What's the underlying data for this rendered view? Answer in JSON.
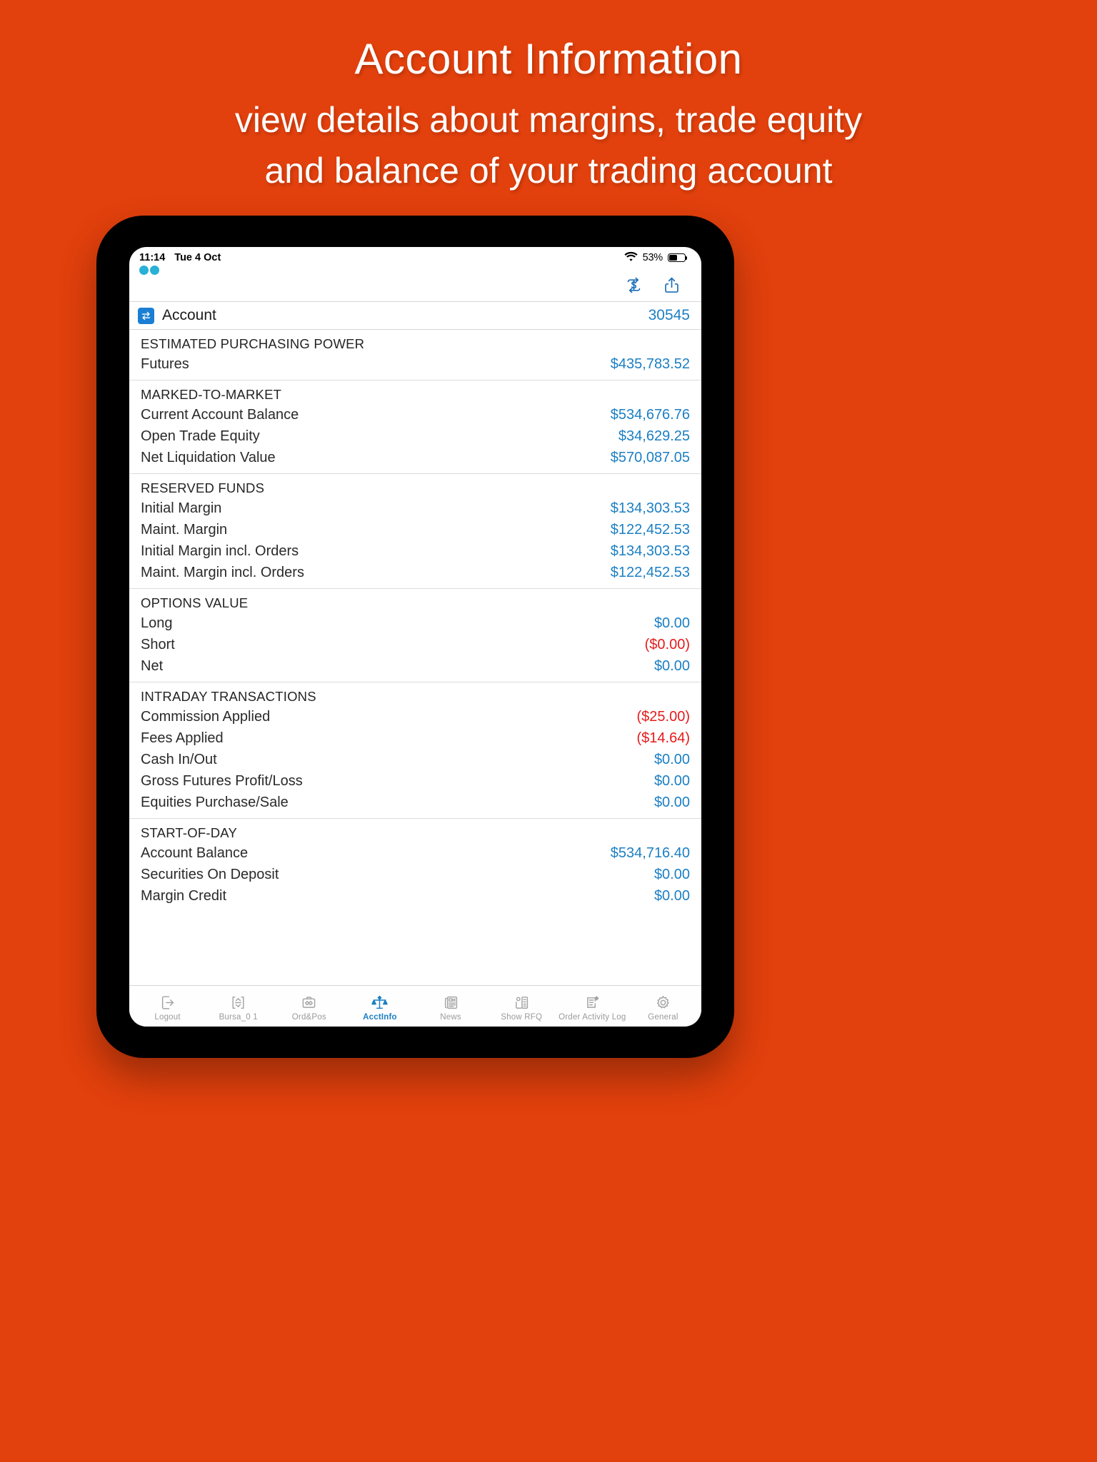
{
  "promo": {
    "title": "Account Information",
    "subtitle_line1": "view details about margins, trade equity",
    "subtitle_line2": "and balance of your trading account",
    "background_color": "#e2400c",
    "text_color": "#ffffff"
  },
  "status_bar": {
    "time": "11:14",
    "date": "Tue 4 Oct",
    "wifi_icon": "wifi-icon",
    "battery_percent": "53%",
    "battery_icon": "battery-icon"
  },
  "toolbar": {
    "currency_refresh_icon": "currency-refresh-icon",
    "share_icon": "share-icon"
  },
  "account": {
    "badge_icon": "switch-account-icon",
    "label": "Account",
    "value": "30545"
  },
  "colors": {
    "value_positive": "#1b7fc4",
    "value_negative": "#e51b1b",
    "accent": "#1b7fc4"
  },
  "sections": [
    {
      "title": "ESTIMATED PURCHASING POWER",
      "rows": [
        {
          "label": "Futures",
          "value": "$435,783.52",
          "tone": "blue"
        }
      ]
    },
    {
      "title": "MARKED-TO-MARKET",
      "rows": [
        {
          "label": "Current Account Balance",
          "value": "$534,676.76",
          "tone": "blue"
        },
        {
          "label": "Open Trade Equity",
          "value": "$34,629.25",
          "tone": "blue"
        },
        {
          "label": "Net Liquidation Value",
          "value": "$570,087.05",
          "tone": "blue"
        }
      ]
    },
    {
      "title": "RESERVED FUNDS",
      "rows": [
        {
          "label": "Initial Margin",
          "value": "$134,303.53",
          "tone": "blue"
        },
        {
          "label": "Maint. Margin",
          "value": "$122,452.53",
          "tone": "blue"
        },
        {
          "label": "Initial Margin incl. Orders",
          "value": "$134,303.53",
          "tone": "blue"
        },
        {
          "label": "Maint. Margin incl. Orders",
          "value": "$122,452.53",
          "tone": "blue"
        }
      ]
    },
    {
      "title": "OPTIONS VALUE",
      "rows": [
        {
          "label": "Long",
          "value": "$0.00",
          "tone": "blue"
        },
        {
          "label": "Short",
          "value": "($0.00)",
          "tone": "red"
        },
        {
          "label": "Net",
          "value": "$0.00",
          "tone": "blue"
        }
      ]
    },
    {
      "title": "INTRADAY TRANSACTIONS",
      "rows": [
        {
          "label": "Commission Applied",
          "value": "($25.00)",
          "tone": "red"
        },
        {
          "label": "Fees Applied",
          "value": "($14.64)",
          "tone": "red"
        },
        {
          "label": "Cash In/Out",
          "value": "$0.00",
          "tone": "blue"
        },
        {
          "label": "Gross Futures Profit/Loss",
          "value": "$0.00",
          "tone": "blue"
        },
        {
          "label": "Equities Purchase/Sale",
          "value": "$0.00",
          "tone": "blue"
        }
      ]
    },
    {
      "title": "START-OF-DAY",
      "rows": [
        {
          "label": "Account Balance",
          "value": "$534,716.40",
          "tone": "blue"
        },
        {
          "label": "Securities On Deposit",
          "value": "$0.00",
          "tone": "blue"
        },
        {
          "label": "Margin Credit",
          "value": "$0.00",
          "tone": "blue"
        }
      ]
    }
  ],
  "tabs": [
    {
      "label": "Logout",
      "icon": "logout-icon",
      "active": false
    },
    {
      "label": "Bursa_0 1",
      "icon": "quote-board-icon",
      "active": false
    },
    {
      "label": "Ord&Pos",
      "icon": "orders-positions-icon",
      "active": false
    },
    {
      "label": "AcctInfo",
      "icon": "scales-icon",
      "active": true
    },
    {
      "label": "News",
      "icon": "news-icon",
      "active": false
    },
    {
      "label": "Show RFQ",
      "icon": "rfq-icon",
      "active": false
    },
    {
      "label": "Order Activity Log",
      "icon": "activity-log-icon",
      "active": false
    },
    {
      "label": "General",
      "icon": "gear-icon",
      "active": false
    }
  ]
}
